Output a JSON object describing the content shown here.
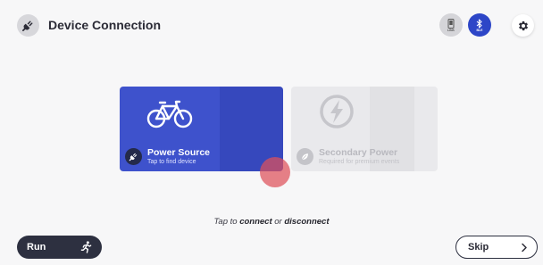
{
  "header": {
    "icon": "plug-icon",
    "title": "Device Connection",
    "connection_types": [
      {
        "label": "LINK",
        "icon": "phone-link-icon",
        "active": false
      },
      {
        "label": "BLE",
        "icon": "bluetooth-icon",
        "active": true
      }
    ],
    "settings_icon": "gear-icon"
  },
  "cards": [
    {
      "id": "power-source",
      "title": "Power Source",
      "subtitle": "Tap to find device",
      "illustration": "bicycle-icon",
      "badge_icon": "plug-icon",
      "state": "selected",
      "color": "#3e52cc"
    },
    {
      "id": "secondary-power",
      "title": "Secondary Power",
      "subtitle": "Required for premium events",
      "illustration": "lightning-icon",
      "badge_icon": "leaf-icon",
      "state": "disabled",
      "color": "#e9e9ec"
    }
  ],
  "hint": {
    "prefix": "Tap to",
    "connect": "connect",
    "middle": "or",
    "disconnect": "disconnect"
  },
  "footer": {
    "run_label": "Run",
    "run_icon": "running-person-icon",
    "skip_label": "Skip",
    "skip_icon": "chevron-right-icon"
  },
  "colors": {
    "accent": "#3e52cc",
    "ble_active": "#2d46c7",
    "dark_button": "#2d3040",
    "tap_indicator": "#de505a"
  }
}
